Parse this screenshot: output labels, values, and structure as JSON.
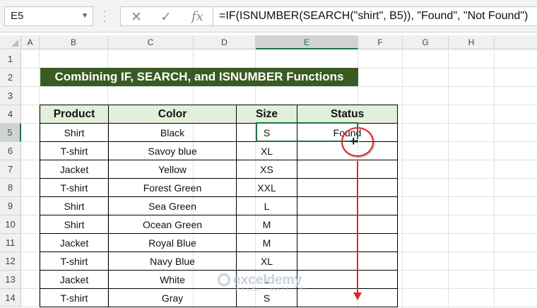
{
  "name_box": {
    "value": "E5"
  },
  "formula_bar": {
    "cancel_icon": "cancel-icon",
    "enter_icon": "check-icon",
    "fx_label": "fx",
    "formula": "=IF(ISNUMBER(SEARCH(\"shirt\", B5)), \"Found\", \"Not Found\")"
  },
  "columns": [
    "A",
    "B",
    "C",
    "D",
    "E",
    "F",
    "G",
    "H"
  ],
  "selected_column": "E",
  "rows": [
    "1",
    "2",
    "3",
    "4",
    "5",
    "6",
    "7",
    "8",
    "9",
    "10",
    "11",
    "12",
    "13",
    "14"
  ],
  "selected_row": "5",
  "sheet": {
    "title": "Combining IF, SEARCH, and ISNUMBER Functions",
    "headers": [
      "Product",
      "Color",
      "Size",
      "Status"
    ],
    "data": [
      [
        "Shirt",
        "Black",
        "S",
        "Found"
      ],
      [
        "T-shirt",
        "Savoy blue",
        "XL",
        ""
      ],
      [
        "Jacket",
        "Yellow",
        "XS",
        ""
      ],
      [
        "T-shirt",
        "Forest Green",
        "XXL",
        ""
      ],
      [
        "Shirt",
        "Sea Green",
        "L",
        ""
      ],
      [
        "Shirt",
        "Ocean Green",
        "M",
        ""
      ],
      [
        "Jacket",
        "Royal Blue",
        "M",
        ""
      ],
      [
        "T-shirt",
        "Navy Blue",
        "XL",
        ""
      ],
      [
        "Jacket",
        "White",
        "L",
        ""
      ],
      [
        "T-shirt",
        "Gray",
        "S",
        ""
      ]
    ]
  },
  "watermark": {
    "name": "exceldemy",
    "tagline": "EXCEL · DATA · BI"
  },
  "colors": {
    "title_bg": "#3a5a24",
    "header_bg": "#e2efda",
    "selection": "#217346",
    "annotation": "#e02424"
  }
}
